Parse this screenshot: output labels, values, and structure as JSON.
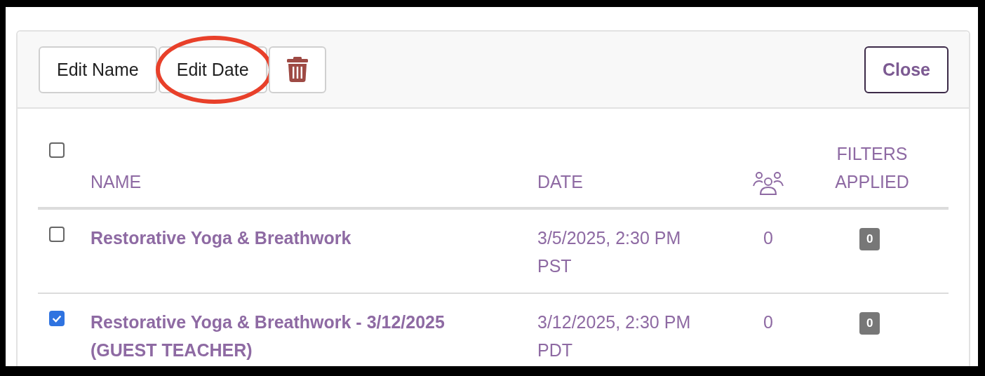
{
  "toolbar": {
    "buttons": [
      {
        "kind": "text",
        "label": "Edit Name",
        "highlighted": false
      },
      {
        "kind": "text",
        "label": "Edit Date",
        "highlighted": true
      },
      {
        "kind": "delete",
        "highlighted": false
      }
    ],
    "close": "Close"
  },
  "table": {
    "select_all": {
      "checked": false
    },
    "columns": [
      {
        "kind": "text",
        "label": "NAME"
      },
      {
        "kind": "text",
        "label": "DATE"
      },
      {
        "kind": "people"
      },
      {
        "kind": "text",
        "label": "FILTERS APPLIED"
      }
    ],
    "rows": [
      {
        "checked": false,
        "name": "Restorative Yoga & Breathwork",
        "date": "3/5/2025, 2:30 PM PST",
        "attendees": "0",
        "filters": "0"
      },
      {
        "checked": true,
        "name": "Restorative Yoga & Breathwork - 3/12/2025 (GUEST TEACHER)",
        "date": "3/12/2025, 2:30 PM PDT",
        "attendees": "0",
        "filters": "0"
      }
    ]
  }
}
